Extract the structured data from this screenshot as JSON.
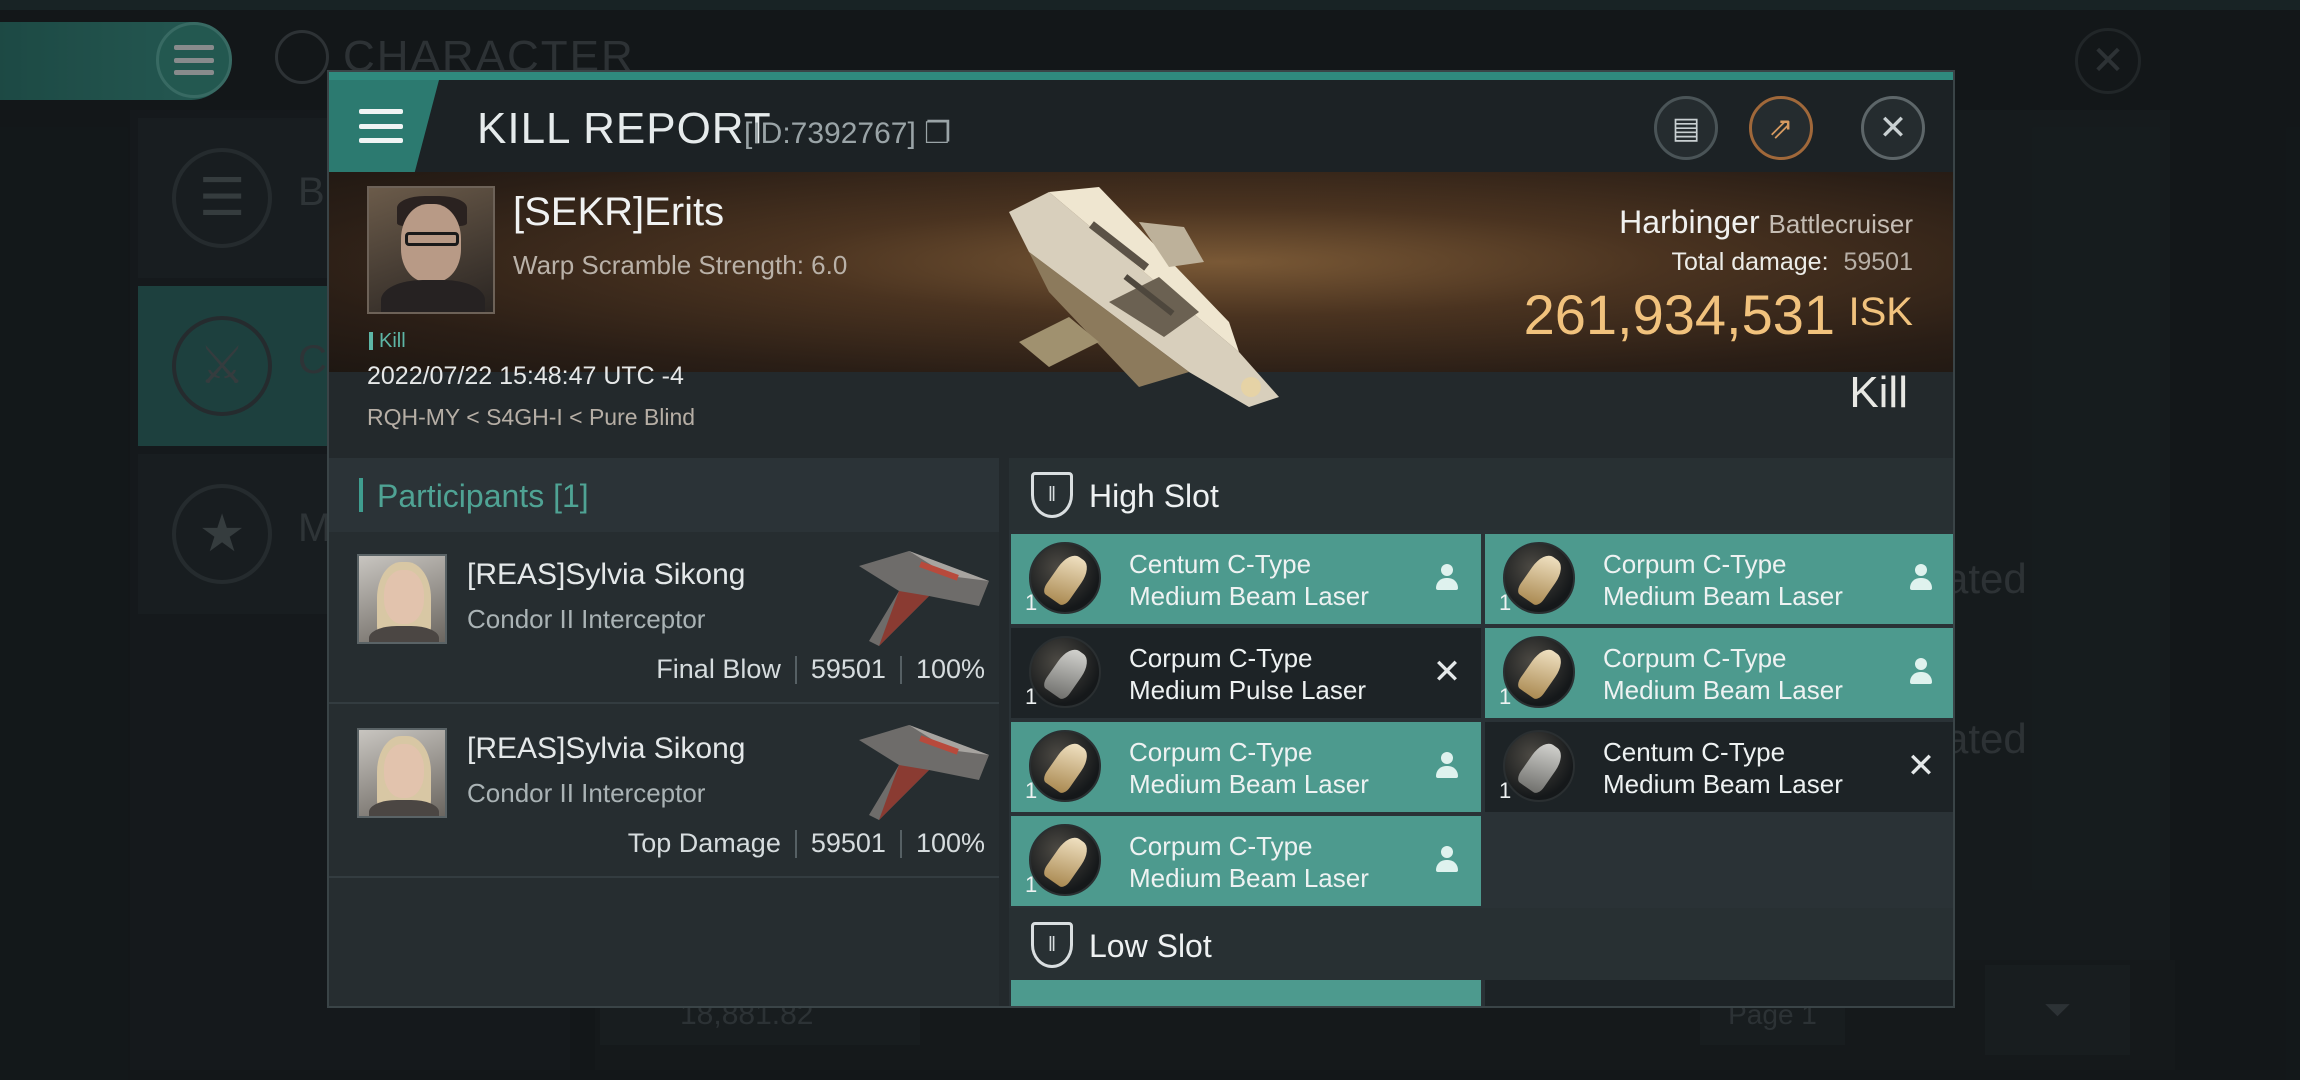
{
  "background": {
    "title": "CHARACTER",
    "sidebar": [
      {
        "label": "Bi",
        "icon": "list-icon"
      },
      {
        "label": "Co",
        "icon": "crossed-swords-icon"
      },
      {
        "label": "Me",
        "icon": "star-badge-icon"
      }
    ],
    "right_texts": [
      "ated",
      "ated"
    ],
    "amount": "18,881.82",
    "page": "Page 1"
  },
  "kill_report": {
    "title": "KILL REPORT",
    "id": "[ID:7392767]",
    "victim": {
      "name": "[SEKR]Erits",
      "warp_scramble": "Warp Scramble Strength: 6.0",
      "tag": "Kill",
      "datetime": "2022/07/22 15:48:47 UTC -4",
      "location": "RQH-MY < S4GH-I < Pure Blind"
    },
    "ship": {
      "name": "Harbinger",
      "class": "Battlecruiser",
      "total_damage_label": "Total damage:",
      "total_damage": "59501",
      "isk_value": "261,934,531",
      "isk_unit": "ISK",
      "result": "Kill"
    },
    "participants": {
      "title": "Participants",
      "count": "[1]",
      "rows": [
        {
          "name": "[REAS]Sylvia Sikong",
          "ship": "Condor II Interceptor",
          "role": "Final Blow",
          "damage": "59501",
          "percent": "100%"
        },
        {
          "name": "[REAS]Sylvia Sikong",
          "ship": "Condor II Interceptor",
          "role": "Top Damage",
          "damage": "59501",
          "percent": "100%"
        }
      ]
    },
    "high_slot": {
      "title": "High Slot",
      "modules": [
        {
          "line1": "Centum C-Type",
          "line2": "Medium Beam Laser",
          "qty": "1",
          "state": "dropped"
        },
        {
          "line1": "Corpum C-Type",
          "line2": "Medium Beam Laser",
          "qty": "1",
          "state": "dropped"
        },
        {
          "line1": "Corpum C-Type",
          "line2": "Medium Pulse Laser",
          "qty": "1",
          "state": "destroyed"
        },
        {
          "line1": "Corpum C-Type",
          "line2": "Medium Beam Laser",
          "qty": "1",
          "state": "dropped"
        },
        {
          "line1": "Corpum C-Type",
          "line2": "Medium Beam Laser",
          "qty": "1",
          "state": "dropped"
        },
        {
          "line1": "Centum C-Type",
          "line2": "Medium Beam Laser",
          "qty": "1",
          "state": "destroyed"
        },
        {
          "line1": "Corpum C-Type",
          "line2": "Medium Beam Laser",
          "qty": "1",
          "state": "dropped"
        }
      ]
    },
    "low_slot": {
      "title": "Low Slot"
    }
  },
  "colors": {
    "accent_teal": "#4d9a8e",
    "isk_gold": "#f1c27d"
  }
}
